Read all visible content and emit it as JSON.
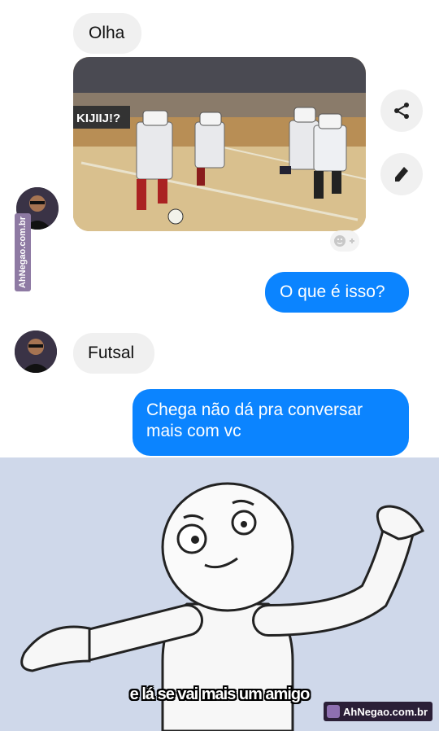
{
  "messages": {
    "first_in": "Olha",
    "out_1": "O que é isso?",
    "second_in": "Futsal",
    "out_2_line1": "Chega não dá pra conversar",
    "out_2_line2": "mais com vc"
  },
  "photo": {
    "banner_text": "KIJIIJ!?"
  },
  "watermarks": {
    "side": "AhNegao.com.br",
    "bottom": "AhNegao.com.br"
  },
  "meme": {
    "caption": "e lá se vai mais um amigo"
  },
  "icons": {
    "share": "share-icon",
    "edit": "pencil-icon",
    "react": "emoji-add-icon"
  },
  "colors": {
    "outgoing": "#0b84ff",
    "incoming": "#f0f0f0",
    "meme_bg": "#cfd8ea"
  }
}
